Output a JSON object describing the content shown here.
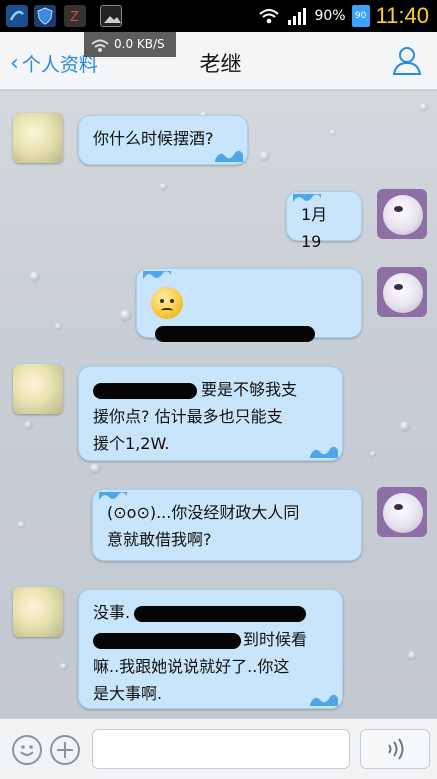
{
  "status_bar": {
    "battery_percent": "90%",
    "battery_badge": "90",
    "time": "11:40",
    "network_speed": "0.0 KB/S"
  },
  "header": {
    "back_label": "个人资料",
    "title": "老继"
  },
  "messages": [
    {
      "side": "left",
      "text": "你什么时候摆酒?"
    },
    {
      "side": "right",
      "text": "1月19"
    },
    {
      "side": "right",
      "emoticon": "worried-face-icon"
    },
    {
      "side": "left",
      "line1": "要是不够我支",
      "line2": "援你点? 估计最多也只能支",
      "line3": "援个1,2W."
    },
    {
      "side": "right",
      "line1": "(⊙o⊙)...你没经财政大人同",
      "line2": "意就敢借我啊?"
    },
    {
      "side": "left",
      "line1_prefix": "没事.",
      "line2_suffix": "到时候看",
      "line3": "嘛..我跟她说说就好了..你这",
      "line4": "是大事啊."
    }
  ],
  "input": {
    "value": "",
    "voice_icon": "voice-icon"
  },
  "colors": {
    "bubble": "#c8e5fb",
    "accent": "#2a8ae0",
    "time": "#ffd21f"
  }
}
